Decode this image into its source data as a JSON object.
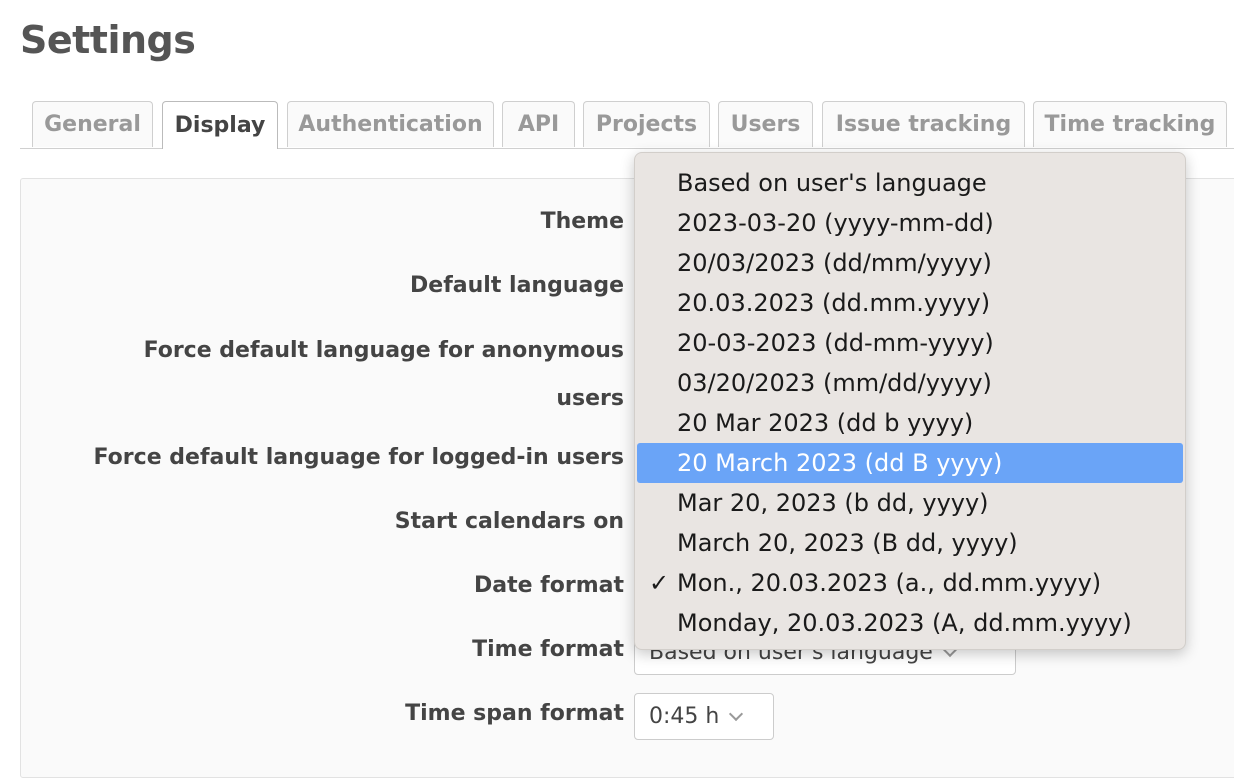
{
  "page": {
    "title": "Settings"
  },
  "tabs": [
    {
      "label": "General",
      "active": false
    },
    {
      "label": "Display",
      "active": true
    },
    {
      "label": "Authentication",
      "active": false
    },
    {
      "label": "API",
      "active": false
    },
    {
      "label": "Projects",
      "active": false
    },
    {
      "label": "Users",
      "active": false
    },
    {
      "label": "Issue tracking",
      "active": false
    },
    {
      "label": "Time tracking",
      "active": false
    }
  ],
  "form": {
    "theme_label": "Theme",
    "default_language_label": "Default language",
    "force_anonymous_label_line1": "Force default language for anonymous",
    "force_anonymous_label_line2": "users",
    "force_logged_in_label": "Force default language for logged-in users",
    "start_calendars_label": "Start calendars on",
    "date_format_label": "Date format",
    "time_format_label": "Time format",
    "time_format_value": "Based on user's language",
    "time_span_label": "Time span format",
    "time_span_value": "0:45 h"
  },
  "date_format_dropdown": {
    "selected": "Mon., 20.03.2023 (a., dd.mm.yyyy)",
    "highlighted": "20 March 2023 (dd B yyyy)",
    "check_glyph": "✓",
    "options": [
      "Based on user's language",
      "2023-03-20 (yyyy-mm-dd)",
      "20/03/2023 (dd/mm/yyyy)",
      "20.03.2023 (dd.mm.yyyy)",
      "20-03-2023 (dd-mm-yyyy)",
      "03/20/2023 (mm/dd/yyyy)",
      "20 Mar 2023 (dd b yyyy)",
      "20 March 2023 (dd B yyyy)",
      "Mar 20, 2023 (b dd, yyyy)",
      "March 20, 2023 (B dd, yyyy)",
      "Mon., 20.03.2023 (a., dd.mm.yyyy)",
      "Monday, 20.03.2023 (A, dd.mm.yyyy)"
    ]
  },
  "icons": {
    "select_arrow": "chevron-down-icon",
    "selected_mark": "checkmark-icon"
  },
  "colors": {
    "highlight": "#6aa4f7",
    "dropdown_bg": "#e9e5e2",
    "panel_bg": "#fafafa"
  }
}
